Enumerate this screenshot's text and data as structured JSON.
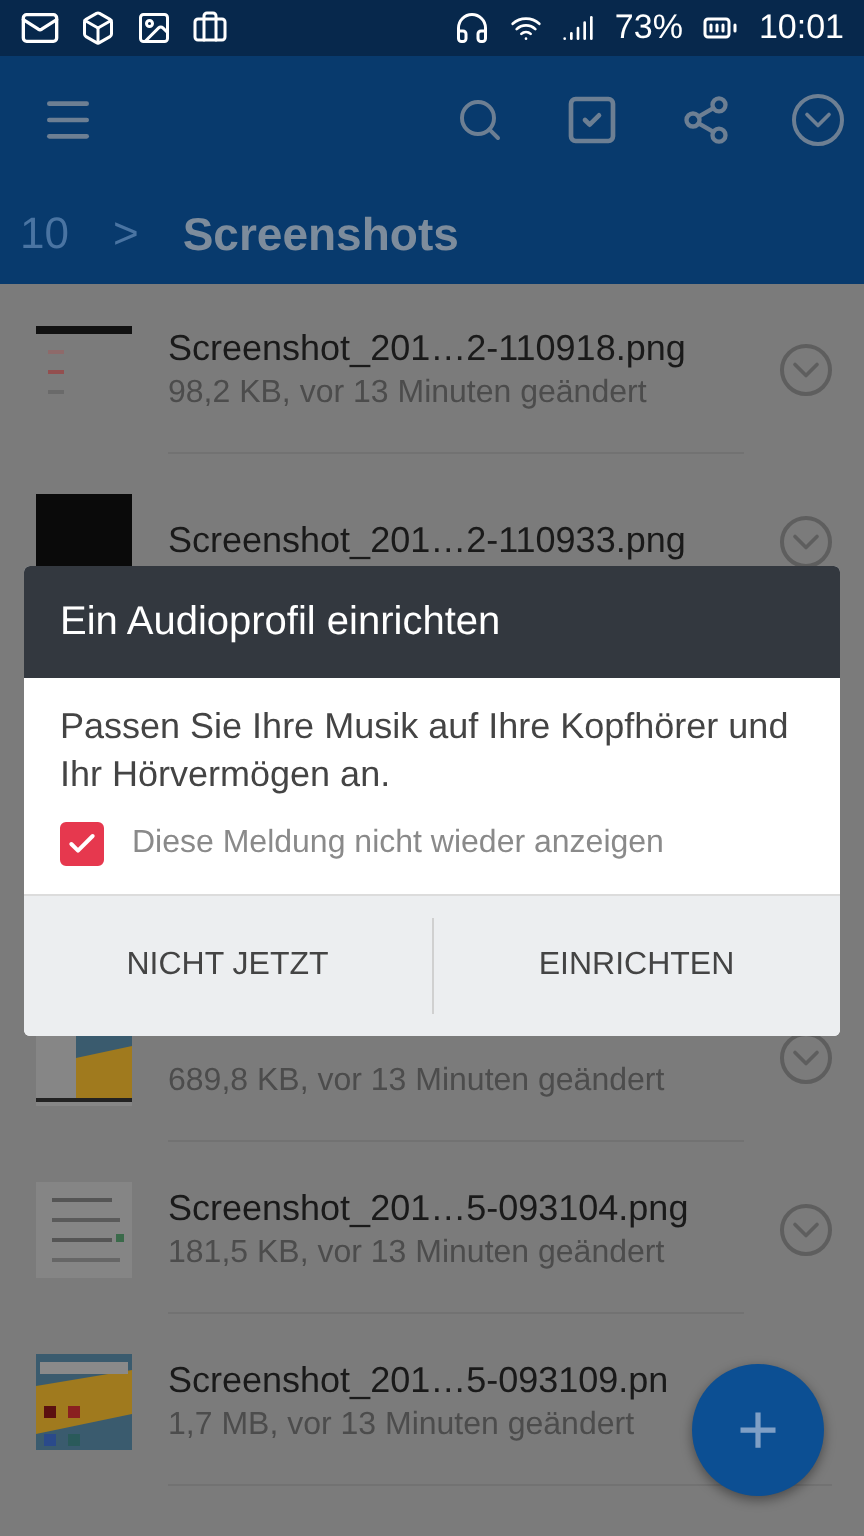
{
  "status_bar": {
    "battery": "73%",
    "time": "10:01"
  },
  "breadcrumb": {
    "parent": "10",
    "separator": ">",
    "current": "Screenshots"
  },
  "files": [
    {
      "name": "Screenshot_201…2-110918.png",
      "meta": "98,2 KB, vor 13 Minuten geändert"
    },
    {
      "name": "Screenshot_201…2-110933.png"
    },
    {
      "meta": "689,8 KB, vor 13 Minuten geändert"
    },
    {
      "name": "Screenshot_201…5-093104.png",
      "meta": "181,5 KB, vor 13 Minuten geändert"
    },
    {
      "name": "Screenshot_201…5-093109.pn",
      "meta": "1,7 MB, vor 13 Minuten geändert"
    }
  ],
  "fab": {
    "label": "+"
  },
  "dialog": {
    "title": "Ein Audioprofil einrichten",
    "message": "Passen Sie Ihre Musik auf Ihre Kopfhörer und Ihr Hörvermögen an.",
    "checkbox": {
      "label": "Diese Meldung nicht wieder anzeigen",
      "checked": true
    },
    "buttons": [
      "NICHT JETZT",
      "EINRICHTEN"
    ]
  }
}
